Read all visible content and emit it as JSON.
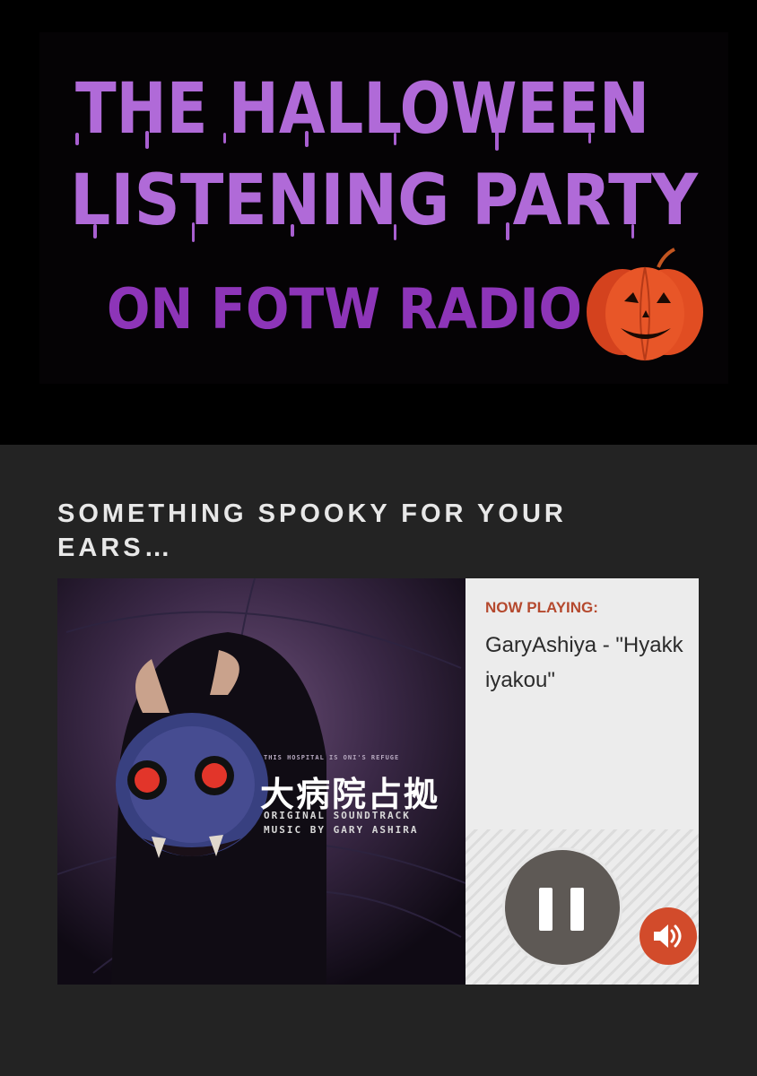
{
  "banner": {
    "line1": "THE HALLOWEEN",
    "line2": "LISTENING PARTY",
    "line3": "ON FOTW RADIO",
    "pumpkin_icon": "jack-o-lantern-icon",
    "title_color": "#b06ad8",
    "subtitle_color": "#8d35b8"
  },
  "section": {
    "heading": "SOMETHING SPOOKY FOR YOUR EARS…"
  },
  "album": {
    "tagline": "THIS HOSPITAL IS ONI'S REFUGE",
    "title": "大病院占拠",
    "line1": "ORIGINAL SOUNDTRACK",
    "line2": "MUSIC BY GARY ASHIRA"
  },
  "player": {
    "now_playing_label": "NOW PLAYING:",
    "track": "GaryAshiya - \"Hyakkiyakou\"",
    "pause_icon": "pause-icon",
    "volume_icon": "speaker-icon",
    "accent": "#d24b2b"
  }
}
